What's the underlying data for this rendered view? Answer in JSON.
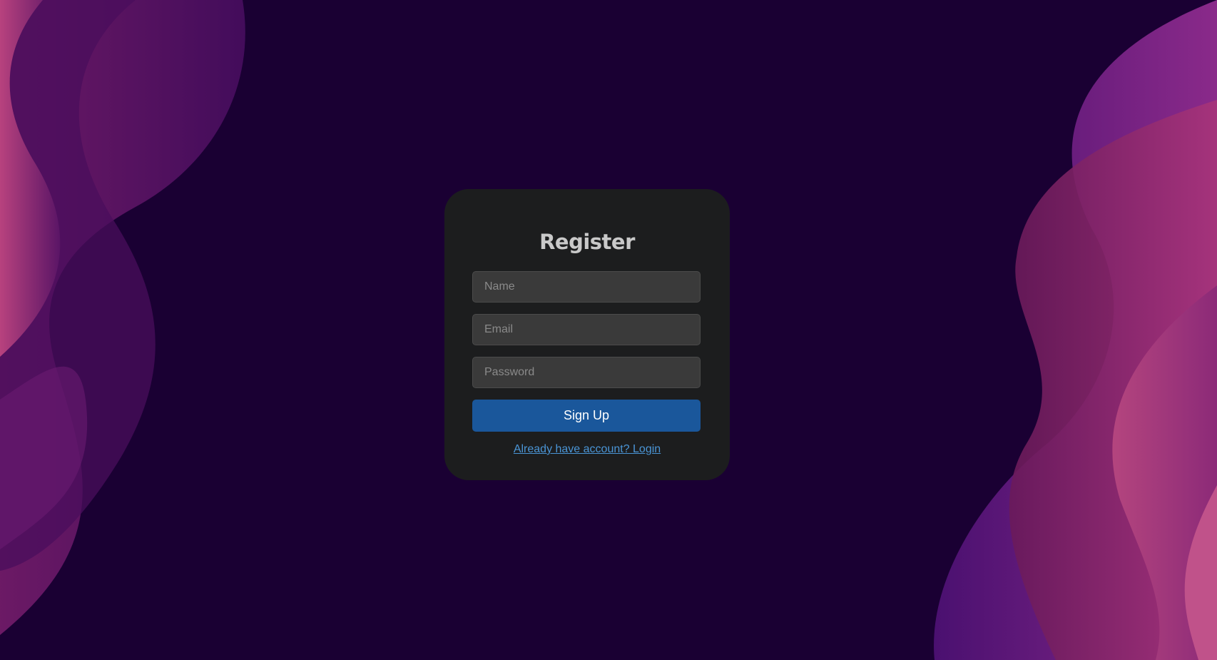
{
  "colors": {
    "background": "#1a0033",
    "card": "#1c1d1e",
    "input": "#3a3a3a",
    "button": "#1a579b",
    "link": "#4a95d6"
  },
  "register": {
    "title": "Register",
    "name_placeholder": "Name",
    "email_placeholder": "Email",
    "password_placeholder": "Password",
    "submit_label": "Sign Up",
    "login_link": "Already have account? Login"
  }
}
